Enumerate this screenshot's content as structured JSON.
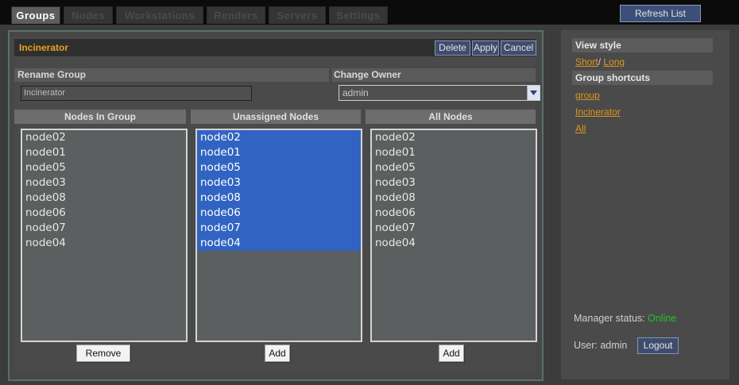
{
  "tabs": [
    {
      "label": "Groups",
      "active": true
    },
    {
      "label": "Nodes",
      "active": false
    },
    {
      "label": "Workstations",
      "active": false
    },
    {
      "label": "Renders",
      "active": false
    },
    {
      "label": "Servers",
      "active": false
    },
    {
      "label": "Settings",
      "active": false
    }
  ],
  "toolbar": {
    "refresh_label": "Refresh List"
  },
  "group": {
    "title": "Incinerator",
    "delete_label": "Delete",
    "apply_label": "Apply",
    "cancel_label": "Cancel",
    "rename_label": "Rename Group",
    "rename_value": "Incinerator",
    "owner_label": "Change Owner",
    "owner_value": "admin"
  },
  "columns": {
    "in_group": {
      "header": "Nodes In Group",
      "button": "Remove",
      "items": [
        "node02",
        "node01",
        "node05",
        "node03",
        "node08",
        "node06",
        "node07",
        "node04"
      ]
    },
    "unassigned": {
      "header": "Unassigned Nodes",
      "button": "Add",
      "items": [
        "node02",
        "node01",
        "node05",
        "node03",
        "node08",
        "node06",
        "node07",
        "node04"
      ]
    },
    "all": {
      "header": "All Nodes",
      "button": "Add",
      "items": [
        "node02",
        "node01",
        "node05",
        "node03",
        "node08",
        "node06",
        "node07",
        "node04"
      ]
    }
  },
  "side": {
    "view_style_label": "View style",
    "short_label": "Short",
    "sep": "/",
    "long_label": "Long",
    "shortcuts_label": "Group shortcuts",
    "shortcuts": [
      "group",
      "Incinerator",
      "All"
    ],
    "status_label": "Manager status:",
    "status_value": "Online",
    "user_label": "User: admin",
    "logout_label": "Logout"
  },
  "colors": {
    "accent_orange": "#e8a21f",
    "selection_blue": "#3164c2",
    "online_green": "#22c22a"
  }
}
